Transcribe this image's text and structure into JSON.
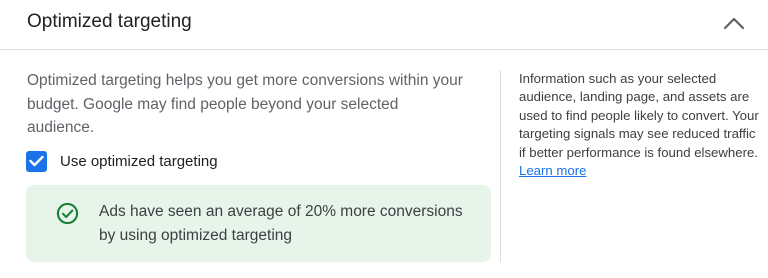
{
  "header": {
    "title": "Optimized targeting",
    "collapse_icon": "chevron-up-icon"
  },
  "main": {
    "description": "Optimized targeting helps you get more conversions within your budget. Google may find people beyond your selected audience.",
    "checkbox": {
      "label": "Use optimized targeting",
      "checked": true
    },
    "info_box": {
      "icon": "check-circle-icon",
      "text": "Ads have seen an average of 20% more conversions by using optimized targeting"
    }
  },
  "side": {
    "text": "Information such as your selected audience, landing page, and assets are used to find people likely to convert. Your targeting signals may see reduced traffic if better performance is found elsewhere.",
    "link_label": "Learn more"
  },
  "colors": {
    "accent": "#1a73e8",
    "success": "#188038",
    "success_bg": "#e6f4ea"
  }
}
